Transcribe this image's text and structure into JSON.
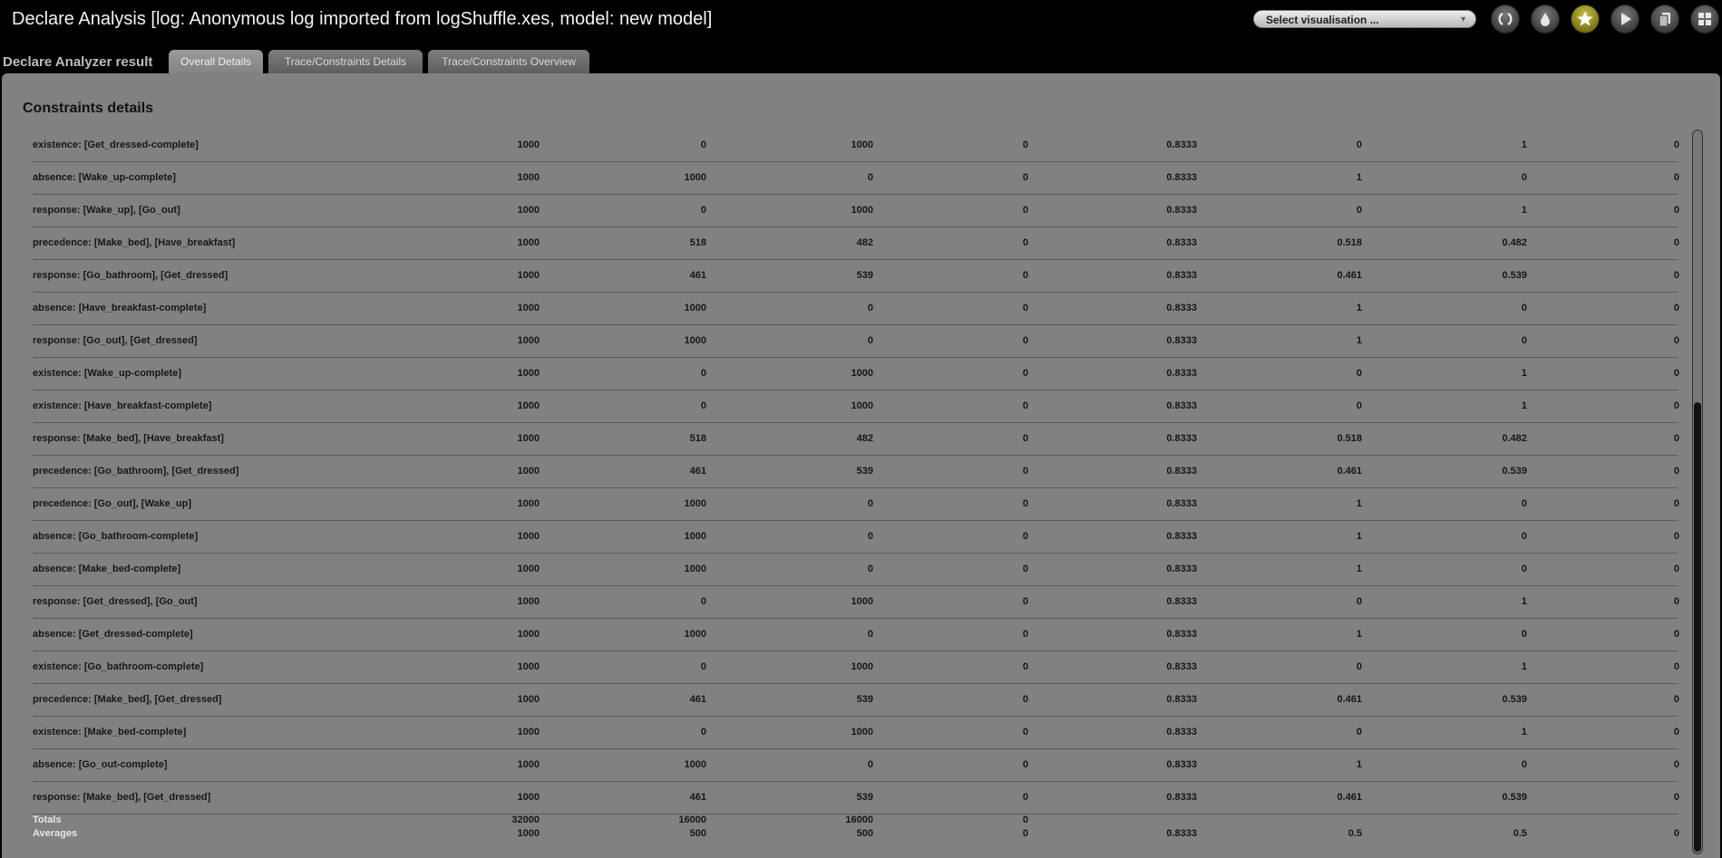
{
  "window": {
    "title": "Declare Analysis [log: Anonymous log imported from logShuffle.xes, model: new model]"
  },
  "toolbar": {
    "select_visualisation": "Select visualisation ...",
    "buttons": [
      {
        "icon": "refresh-icon"
      },
      {
        "icon": "drop-icon"
      },
      {
        "icon": "star-icon",
        "active": true
      },
      {
        "icon": "play-icon"
      },
      {
        "icon": "copy-icon"
      },
      {
        "icon": "grid-icon"
      }
    ],
    "active_color": "#b6ad2c"
  },
  "panel": {
    "label": "Declare Analyzer result",
    "tabs": [
      {
        "label": "Overall Details",
        "selected": true
      },
      {
        "label": "Trace/Constraints Details",
        "selected": false
      },
      {
        "label": "Trace/Constraints Overview",
        "selected": false
      }
    ]
  },
  "section": {
    "title": "Constraints details"
  },
  "rows": [
    [
      "existence: [Get_dressed-complete]",
      "1000",
      "0",
      "1000",
      "0",
      "0.8333",
      "0",
      "1",
      "0"
    ],
    [
      "absence: [Wake_up-complete]",
      "1000",
      "1000",
      "0",
      "0",
      "0.8333",
      "1",
      "0",
      "0"
    ],
    [
      "response: [Wake_up], [Go_out]",
      "1000",
      "0",
      "1000",
      "0",
      "0.8333",
      "0",
      "1",
      "0"
    ],
    [
      "precedence: [Make_bed], [Have_breakfast]",
      "1000",
      "518",
      "482",
      "0",
      "0.8333",
      "0.518",
      "0.482",
      "0"
    ],
    [
      "response: [Go_bathroom], [Get_dressed]",
      "1000",
      "461",
      "539",
      "0",
      "0.8333",
      "0.461",
      "0.539",
      "0"
    ],
    [
      "absence: [Have_breakfast-complete]",
      "1000",
      "1000",
      "0",
      "0",
      "0.8333",
      "1",
      "0",
      "0"
    ],
    [
      "response: [Go_out], [Get_dressed]",
      "1000",
      "1000",
      "0",
      "0",
      "0.8333",
      "1",
      "0",
      "0"
    ],
    [
      "existence: [Wake_up-complete]",
      "1000",
      "0",
      "1000",
      "0",
      "0.8333",
      "0",
      "1",
      "0"
    ],
    [
      "existence: [Have_breakfast-complete]",
      "1000",
      "0",
      "1000",
      "0",
      "0.8333",
      "0",
      "1",
      "0"
    ],
    [
      "response: [Make_bed], [Have_breakfast]",
      "1000",
      "518",
      "482",
      "0",
      "0.8333",
      "0.518",
      "0.482",
      "0"
    ],
    [
      "precedence: [Go_bathroom], [Get_dressed]",
      "1000",
      "461",
      "539",
      "0",
      "0.8333",
      "0.461",
      "0.539",
      "0"
    ],
    [
      "precedence: [Go_out], [Wake_up]",
      "1000",
      "1000",
      "0",
      "0",
      "0.8333",
      "1",
      "0",
      "0"
    ],
    [
      "absence: [Go_bathroom-complete]",
      "1000",
      "1000",
      "0",
      "0",
      "0.8333",
      "1",
      "0",
      "0"
    ],
    [
      "absence: [Make_bed-complete]",
      "1000",
      "1000",
      "0",
      "0",
      "0.8333",
      "1",
      "0",
      "0"
    ],
    [
      "response: [Get_dressed], [Go_out]",
      "1000",
      "0",
      "1000",
      "0",
      "0.8333",
      "0",
      "1",
      "0"
    ],
    [
      "absence: [Get_dressed-complete]",
      "1000",
      "1000",
      "0",
      "0",
      "0.8333",
      "1",
      "0",
      "0"
    ],
    [
      "existence: [Go_bathroom-complete]",
      "1000",
      "0",
      "1000",
      "0",
      "0.8333",
      "0",
      "1",
      "0"
    ],
    [
      "precedence: [Make_bed], [Get_dressed]",
      "1000",
      "461",
      "539",
      "0",
      "0.8333",
      "0.461",
      "0.539",
      "0"
    ],
    [
      "existence: [Make_bed-complete]",
      "1000",
      "0",
      "1000",
      "0",
      "0.8333",
      "0",
      "1",
      "0"
    ],
    [
      "absence: [Go_out-complete]",
      "1000",
      "1000",
      "0",
      "0",
      "0.8333",
      "1",
      "0",
      "0"
    ],
    [
      "response: [Make_bed], [Get_dressed]",
      "1000",
      "461",
      "539",
      "0",
      "0.8333",
      "0.461",
      "0.539",
      "0"
    ]
  ],
  "totals": {
    "label": "Totals",
    "values": [
      "32000",
      "16000",
      "16000",
      "0",
      "",
      "",
      "",
      ""
    ]
  },
  "averages": {
    "label": "Averages",
    "values": [
      "1000",
      "500",
      "500",
      "0",
      "0.8333",
      "0.5",
      "0.5",
      "0"
    ]
  }
}
